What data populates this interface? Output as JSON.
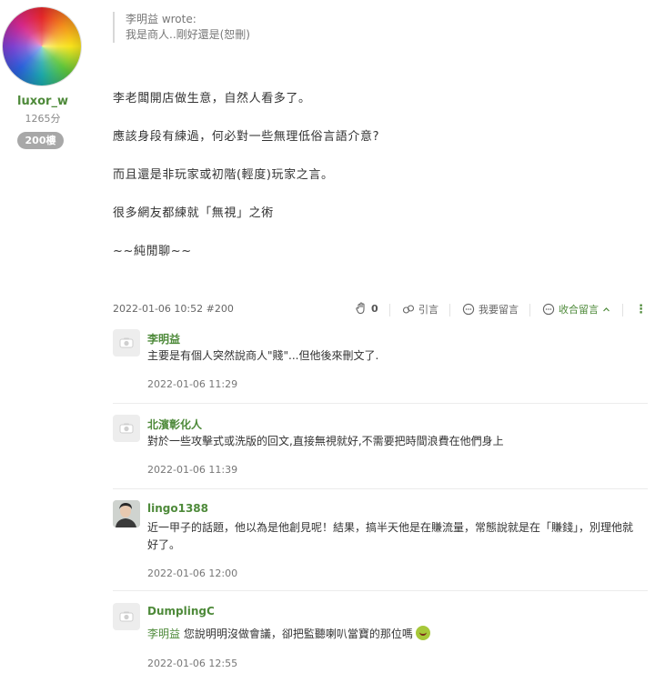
{
  "author": {
    "name": "luxor_w",
    "points": "1265分",
    "floor": "200樓"
  },
  "quote": {
    "author": "李明益 wrote:",
    "text": "我是商人..剛好還是(恕刪)"
  },
  "body": {
    "lines": [
      "李老闆開店做生意，自然人看多了。",
      "應該身段有練過，何必對一些無理低俗言語介意?",
      "而且還是非玩家或初階(輕度)玩家之言。",
      "很多網友都練就「無視」之術",
      "~~純閒聊~~"
    ]
  },
  "meta": {
    "timestamp": "2022-01-06 10:52 #200",
    "clap_count": "0",
    "quote_label": "引言",
    "reply_label": "我要留言",
    "collapse_label": "收合留言",
    "more_label": "⋮"
  },
  "comments": [
    {
      "name": "李明益",
      "text": "主要是有個人突然說商人\"賤\"...但他後來刪文了.",
      "time": "2022-01-06 11:29"
    },
    {
      "name": "北濱彰化人",
      "text": "對於一些攻擊式或洗版的回文,直接無視就好,不需要把時間浪費在他們身上",
      "time": "2022-01-06 11:39"
    },
    {
      "name": "lingo1388",
      "text_line1": "近一甲子的話題，他以為是他創見呢！結果，搞半天他是在賺流量，常態說就是在「賺錢」，別理他就",
      "text_line2": "好了。",
      "time": "2022-01-06 12:00"
    },
    {
      "name": "DumplingC",
      "mention": "李明益",
      "text": " 您說明明沒做會議，卻把監聽喇叭當寶的那位嗎",
      "time": "2022-01-06 12:55"
    }
  ],
  "colors": {
    "accent": "#4e8a3a",
    "badge": "#a8a8a8"
  }
}
